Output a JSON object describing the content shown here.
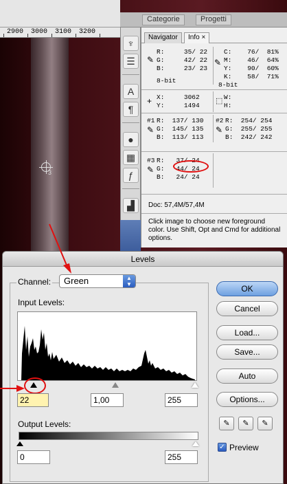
{
  "ruler": {
    "ticks": [
      "2900",
      "3000",
      "3100",
      "3200"
    ]
  },
  "canvas": {
    "sampler_label": "3"
  },
  "top_tabs": {
    "categorie": "Categorie",
    "progetti": "Progetti"
  },
  "info_panel": {
    "tab_navigator": "Navigator",
    "tab_info": "Info",
    "rgb_block": {
      "r": "R:     35/ 22",
      "g": "G:     42/ 22",
      "b": "B:     23/ 23",
      "bits": "8-bit"
    },
    "cmyk_block": {
      "c": "C:    76/  81%",
      "m": "M:    46/  64%",
      "y": "Y:    90/  60%",
      "k": "K:    58/  71%",
      "bits": "8-bit"
    },
    "xy_block": {
      "x": "X:     3062",
      "y": "Y:     1494"
    },
    "wh_block": {
      "w": "W:",
      "h": "H:"
    },
    "s1": {
      "label": "#1",
      "r": "R:  137/ 130",
      "g": "G:  145/ 135",
      "b": "B:  113/ 113"
    },
    "s2": {
      "label": "#2",
      "r": "R:  254/ 254",
      "g": "G:  255/ 255",
      "b": "B:  242/ 242"
    },
    "s3": {
      "label": "#3",
      "r": "R:   37/ 24",
      "g": "G:   44/ 24",
      "b": "B:   24/ 24"
    },
    "doc": "Doc: 57,4M/57,4M",
    "hint": "Click image to choose new foreground color.  Use Shift, Opt and Cmd for additional options."
  },
  "levels_dialog": {
    "title": "Levels",
    "channel_label": "Channel:",
    "channel_value": "Green",
    "input_label": "Input Levels:",
    "input_black": "22",
    "input_gamma": "1,00",
    "input_white": "255",
    "output_label": "Output Levels:",
    "output_black": "0",
    "output_white": "255",
    "buttons": {
      "ok": "OK",
      "cancel": "Cancel",
      "load": "Load...",
      "save": "Save...",
      "auto": "Auto",
      "options": "Options..."
    },
    "preview_label": "Preview",
    "preview_checked": true
  },
  "accent_colors": {
    "highlight_red": "#e01010",
    "button_blue": "#6ea0e0",
    "window_dark_red": "#4a1218"
  }
}
